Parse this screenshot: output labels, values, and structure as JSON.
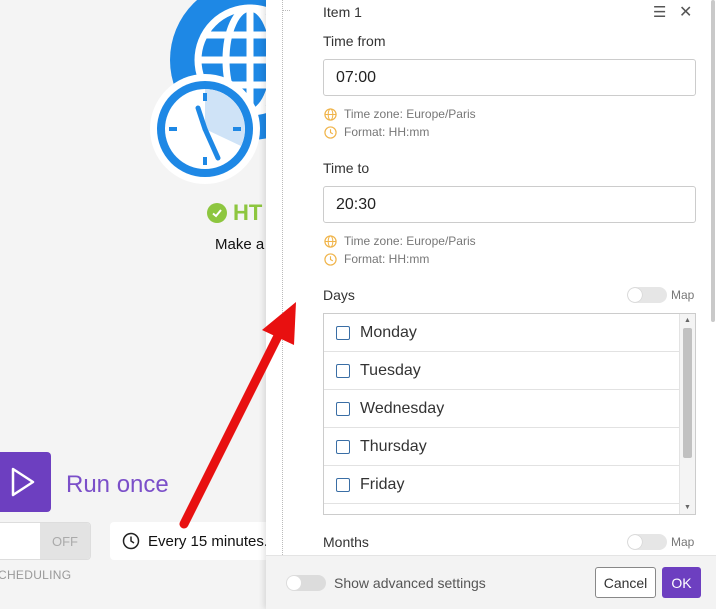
{
  "background": {
    "module_name": "HT",
    "module_description": "Make a",
    "run_once_label": "Run once",
    "toggle_off_label": "OFF",
    "scheduling_label": "CHEDULING",
    "schedule_text": "Every 15 minutes."
  },
  "panel": {
    "item_title": "Item 1",
    "time_from": {
      "label": "Time from",
      "value": "07:00",
      "hints": [
        "Time zone: Europe/Paris",
        "Format: HH:mm"
      ]
    },
    "time_to": {
      "label": "Time to",
      "value": "20:30",
      "hints": [
        "Time zone: Europe/Paris",
        "Format: HH:mm"
      ]
    },
    "days": {
      "label": "Days",
      "map_label": "Map",
      "options": [
        "Monday",
        "Tuesday",
        "Wednesday",
        "Thursday",
        "Friday"
      ]
    },
    "months": {
      "label": "Months",
      "map_label": "Map"
    }
  },
  "footer": {
    "advanced_label": "Show advanced settings",
    "cancel_label": "Cancel",
    "ok_label": "OK"
  },
  "colors": {
    "accent": "#6d3fc0",
    "success": "#8dc63f",
    "module_blue": "#1e88e5",
    "hint_icon": "#f0b44a",
    "arrow": "#e81010"
  },
  "icons": {
    "menu": "hamburger-icon",
    "close": "close-icon",
    "timezone": "globe-icon",
    "format": "clock-icon",
    "play": "play-icon",
    "schedule": "clock-icon"
  }
}
